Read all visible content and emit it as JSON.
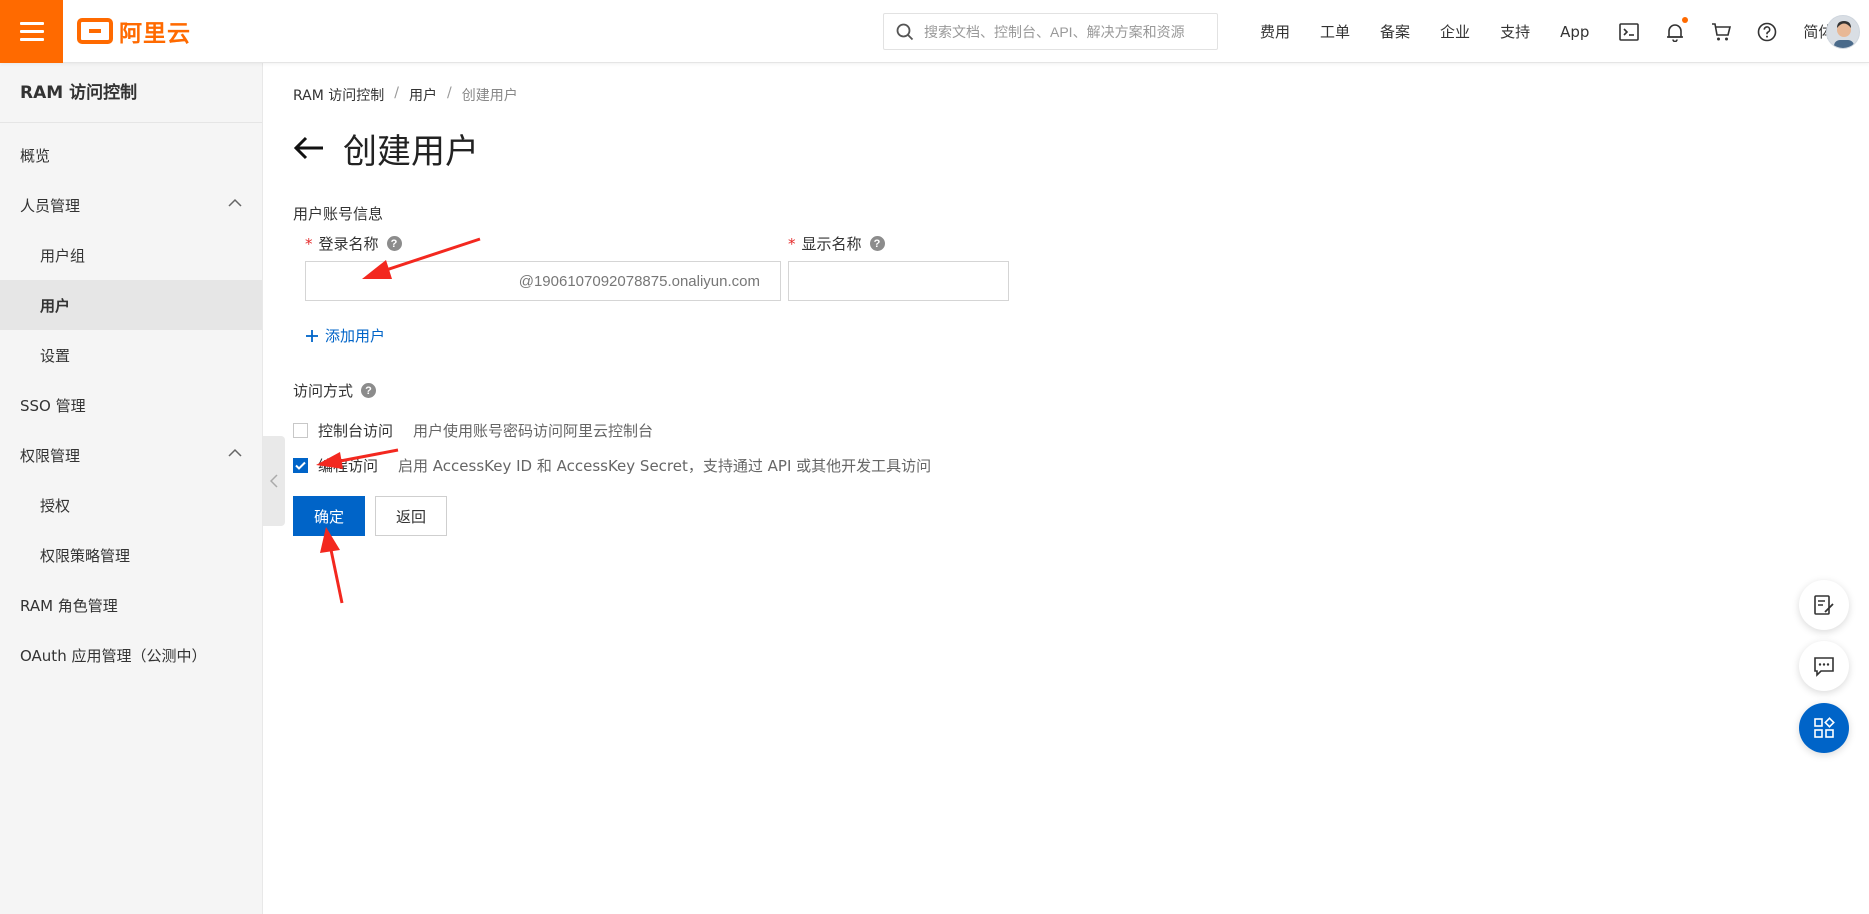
{
  "brand": {
    "logo_text": "阿里云",
    "accent": "#ff6a00",
    "primary": "#0064c8"
  },
  "header": {
    "search_placeholder": "搜索文档、控制台、API、解决方案和资源",
    "nav": [
      "费用",
      "工单",
      "备案",
      "企业",
      "支持",
      "App"
    ],
    "icons": [
      "terminal-icon",
      "bell-icon",
      "cart-icon",
      "help-icon"
    ],
    "lang": "简体"
  },
  "sidebar": {
    "title": "RAM 访问控制",
    "items": [
      {
        "label": "概览"
      },
      {
        "label": "人员管理"
      },
      {
        "label": "用户组"
      },
      {
        "label": "用户"
      },
      {
        "label": "设置"
      },
      {
        "label": "SSO 管理"
      },
      {
        "label": "权限管理"
      },
      {
        "label": "授权"
      },
      {
        "label": "权限策略管理"
      },
      {
        "label": "RAM 角色管理"
      },
      {
        "label": "OAuth 应用管理（公测中）"
      }
    ]
  },
  "breadcrumb": [
    "RAM 访问控制",
    "用户",
    "创建用户"
  ],
  "page": {
    "title": "创建用户"
  },
  "form": {
    "section_account": "用户账号信息",
    "login_name_label": "登录名称",
    "login_name_value": "",
    "login_suffix": "@1906107092078875.onaliyun.com",
    "display_name_label": "显示名称",
    "display_name_value": "",
    "add_user": "添加用户",
    "access_section": "访问方式",
    "console_access_label": "控制台访问",
    "console_access_desc": "用户使用账号密码访问阿里云控制台",
    "console_access_checked": false,
    "api_access_label": "编程访问",
    "api_access_desc": "启用 AccessKey ID 和 AccessKey Secret，支持通过 API 或其他开发工具访问",
    "api_access_checked": true,
    "confirm": "确定",
    "back": "返回"
  },
  "annotations": {
    "arrow_color": "#f3281f"
  }
}
